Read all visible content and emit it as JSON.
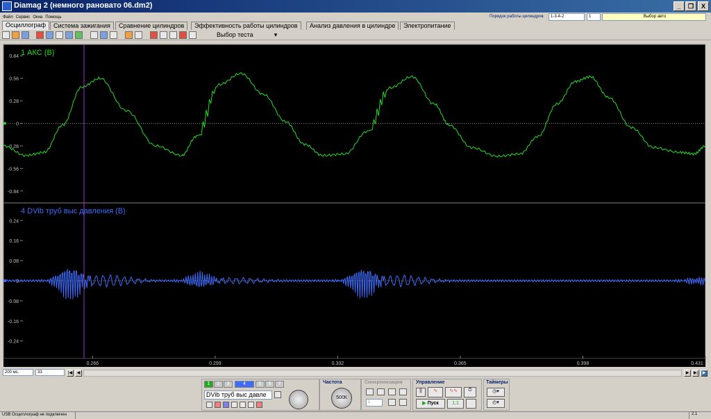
{
  "window": {
    "title": "Diamag 2 (немного рановато 06.dm2)",
    "min": "_",
    "max": "❐",
    "close": "X"
  },
  "menu": [
    "Файл",
    "Сервис",
    "Окна",
    "Помощь"
  ],
  "cyl_order": {
    "label": "Порядок работы цилиндров",
    "value": "1-3-4-2",
    "num": "1",
    "auto": "Выбор авто"
  },
  "tabs": [
    "Осциллограф",
    "Система зажигания",
    "Сравнение цилиндров",
    "Эффективность работы цилиндров",
    "Анализ давления в цилиндре",
    "Электропитание"
  ],
  "test_select": "Выбор теста",
  "channels": [
    {
      "label": "1 АКС (В)",
      "color": "#22dd22",
      "yticks": [
        "0.84",
        "0.56",
        "0.28",
        "0",
        "-0.28",
        "-0.56",
        "-0.84"
      ]
    },
    {
      "label": "4 DVib труб выс давления (В)",
      "color": "#3d6cff",
      "yticks": [
        "0.24",
        "0.16",
        "0.08",
        "0",
        "-0.08",
        "-0.16",
        "-0.24"
      ]
    }
  ],
  "xticks": [
    "0.266",
    "0.299",
    "0.332",
    "0.365",
    "0.398",
    "0.431"
  ],
  "chart_data": {
    "type": "line",
    "x_unit": "s",
    "xlim": [
      0.242,
      0.431
    ],
    "series": [
      {
        "name": "1 АКС (В)",
        "ylim": [
          -0.98,
          0.98
        ],
        "x": [
          0.242,
          0.248,
          0.253,
          0.258,
          0.263,
          0.268,
          0.275,
          0.283,
          0.29,
          0.294,
          0.3,
          0.306,
          0.312,
          0.318,
          0.323,
          0.328,
          0.334,
          0.34,
          0.346,
          0.352,
          0.358,
          0.362,
          0.368,
          0.375,
          0.381,
          0.386,
          0.391,
          0.396,
          0.4,
          0.405,
          0.411,
          0.417,
          0.424,
          0.428,
          0.431
        ],
        "values": [
          -0.28,
          -0.4,
          -0.36,
          -0.02,
          0.45,
          0.56,
          0.16,
          -0.28,
          -0.4,
          -0.16,
          0.48,
          0.62,
          0.36,
          0.02,
          -0.26,
          -0.4,
          -0.38,
          -0.1,
          0.44,
          0.58,
          0.24,
          -0.02,
          -0.3,
          -0.41,
          -0.38,
          -0.16,
          0.24,
          0.52,
          0.58,
          0.32,
          -0.05,
          -0.3,
          -0.36,
          -0.38,
          -0.28
        ]
      },
      {
        "name": "4 DVib труб выс давления (В)",
        "ylim": [
          -0.31,
          0.31
        ],
        "bursts": [
          {
            "x": 0.26,
            "amp": 0.075
          },
          {
            "x": 0.295,
            "amp": 0.035
          },
          {
            "x": 0.339,
            "amp": 0.07
          },
          {
            "x": 0.429,
            "amp": 0.015
          }
        ],
        "baseline": 0
      }
    ]
  },
  "bottom": {
    "timebase": "200 мс.",
    "zoom": "33"
  },
  "panel": {
    "channel_buttons": [
      "1",
      "2",
      "3",
      "4",
      "5",
      "6",
      "7"
    ],
    "channel_select": "DVib труб выс давле",
    "freq_title": "Частота",
    "freq_value": "500К",
    "sync_title": "Синхронизация",
    "sync_value": "1",
    "control_title": "Управление",
    "start": "Пуск",
    "ratio": "1:1",
    "timers_title": "Таймеры"
  },
  "status": {
    "left": "USB Осциллограф не подключен",
    "right": "2.1"
  }
}
